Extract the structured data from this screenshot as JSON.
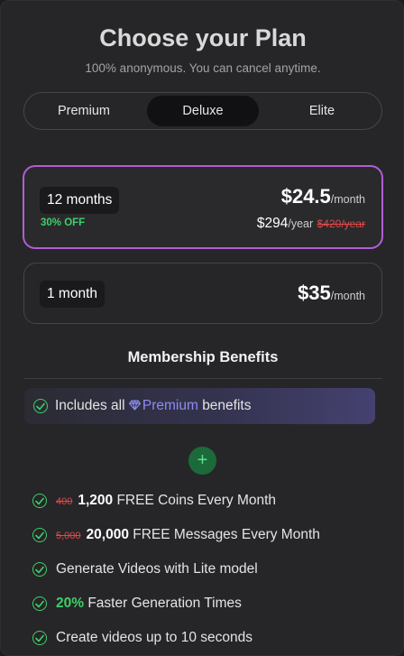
{
  "header": {
    "title": "Choose your Plan",
    "subtitle": "100% anonymous. You can cancel anytime."
  },
  "tabs": [
    {
      "label": "Premium",
      "active": false
    },
    {
      "label": "Deluxe",
      "active": true
    },
    {
      "label": "Elite",
      "active": false
    }
  ],
  "plans": [
    {
      "duration": "12 months",
      "discount": "30% OFF",
      "price": "$24.5",
      "price_unit": "/month",
      "yearly_price": "$294",
      "yearly_unit": "/year",
      "original_yearly": "$420/year",
      "selected": true
    },
    {
      "duration": "1 month",
      "price": "$35",
      "price_unit": "/month",
      "selected": false
    }
  ],
  "benefits": {
    "title": "Membership Benefits",
    "includes": {
      "prefix": "Includes all",
      "tier": "Premium",
      "suffix": "benefits"
    },
    "items": [
      {
        "old": "400",
        "highlight": "1,200",
        "text": "FREE Coins Every Month"
      },
      {
        "old": "5,000",
        "highlight": "20,000",
        "text": "FREE Messages Every Month"
      },
      {
        "text": "Generate Videos with Lite model"
      },
      {
        "highlight": "20%",
        "text": "Faster Generation Times"
      },
      {
        "text": "Create videos up to 10 seconds"
      }
    ]
  },
  "colors": {
    "accent_border": "#b05ed6",
    "check_green": "#3ecf6a",
    "strike_red": "#e04848",
    "premium_purple": "#8e8cf2"
  },
  "icons": {
    "check": "check-circle-icon",
    "gem": "gem-icon",
    "plus": "plus-icon"
  }
}
